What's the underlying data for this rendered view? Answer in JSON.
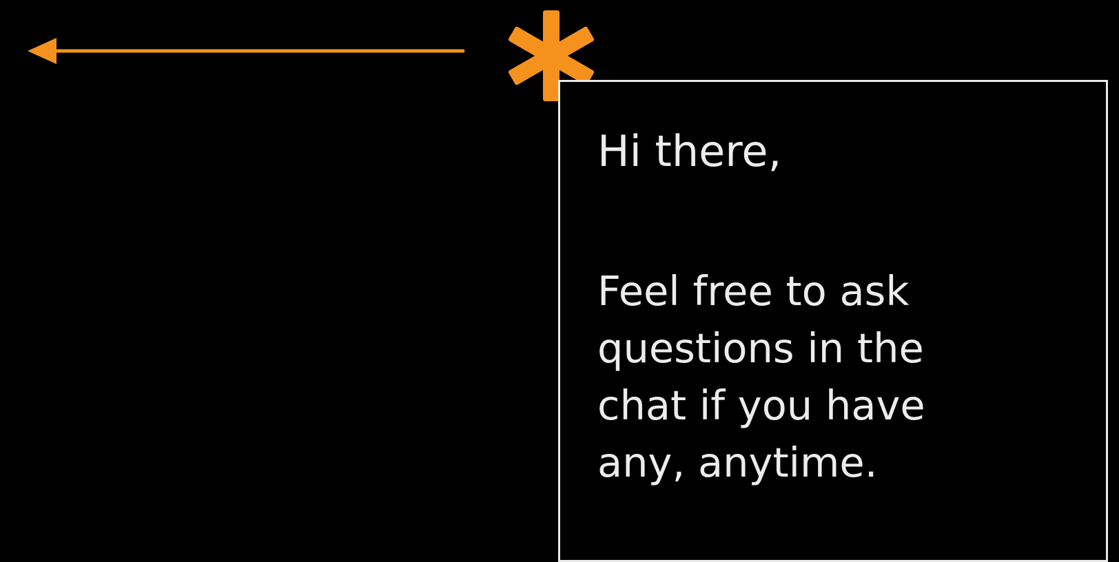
{
  "colors": {
    "background": "#000000",
    "accent": "#f5921e",
    "border": "#e9e9e9",
    "text": "#ececec"
  },
  "icons": {
    "arrow": "left-arrow-icon",
    "asterisk": "asterisk-icon"
  },
  "message": {
    "greeting": "Hi there,",
    "lines": [
      "Feel free to ask",
      "questions in the",
      "chat if you have",
      "any, anytime."
    ]
  }
}
